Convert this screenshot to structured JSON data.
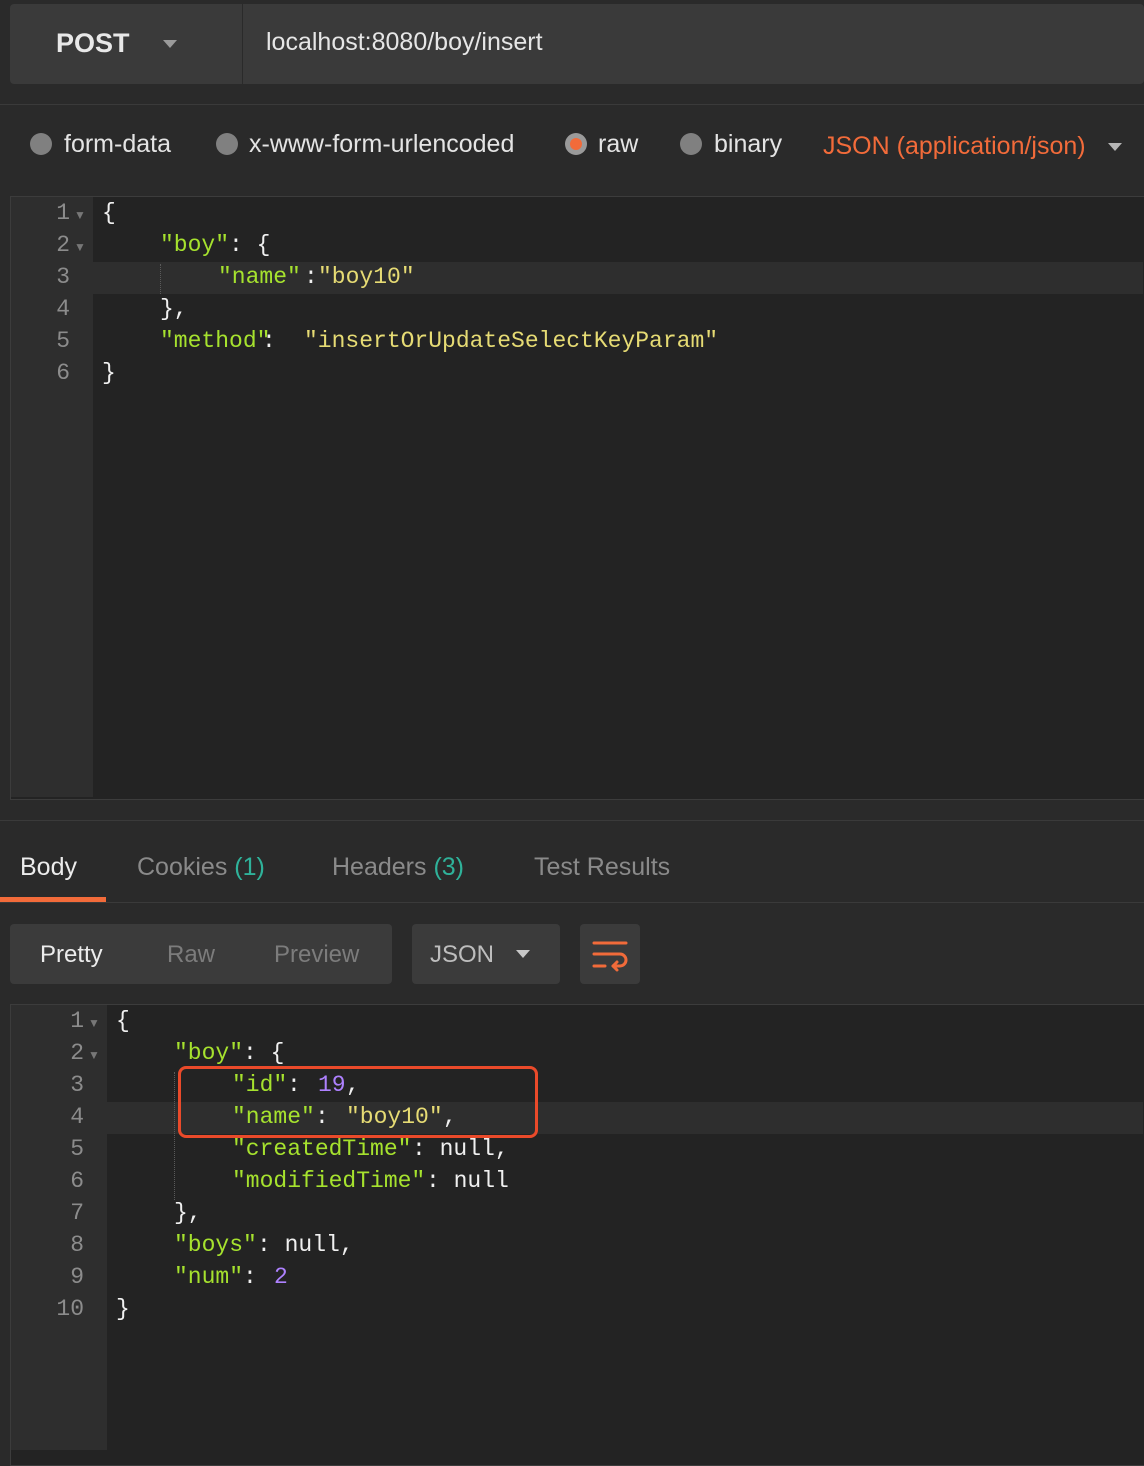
{
  "request": {
    "method": "POST",
    "url": "localhost:8080/boy/insert"
  },
  "body_types": {
    "options": [
      "form-data",
      "x-www-form-urlencoded",
      "raw",
      "binary"
    ],
    "selected": "raw",
    "content_type": "JSON (application/json)"
  },
  "request_body": {
    "line_numbers": [
      "1",
      "2",
      "3",
      "4",
      "5",
      "6"
    ],
    "tokens": {
      "open_brace": "{",
      "boy_key": "\"boy\"",
      "boy_colon": ": {",
      "name_key": "\"name\"",
      "name_colon": ":",
      "name_value": "\"boy10\"",
      "boy_close": "},",
      "method_key": "\"method\"",
      "method_colon": ": ",
      "method_value": "\"insertOrUpdateSelectKeyParam\"",
      "close_brace": "}"
    }
  },
  "response": {
    "tabs": [
      {
        "label": "Body",
        "count": ""
      },
      {
        "label": "Cookies",
        "count": "(1)"
      },
      {
        "label": "Headers",
        "count": "(3)"
      },
      {
        "label": "Test Results",
        "count": ""
      }
    ],
    "active_tab": "Body",
    "view_modes": [
      "Pretty",
      "Raw",
      "Preview"
    ],
    "active_view": "Pretty",
    "format": "JSON",
    "icons": {
      "wrap": "wrap-lines-icon"
    },
    "accent_color": "#f26b3a",
    "highlight_color": "#ea4a2a"
  },
  "response_body": {
    "line_numbers": [
      "1",
      "2",
      "3",
      "4",
      "5",
      "6",
      "7",
      "8",
      "9",
      "10"
    ],
    "tokens": {
      "open_brace": "{",
      "boy_key": "\"boy\"",
      "boy_colon": ": {",
      "id_key": "\"id\"",
      "id_colon": ": ",
      "id_value": "19",
      "id_comma": ",",
      "name_key": "\"name\"",
      "name_colon": ": ",
      "name_value": "\"boy10\"",
      "name_comma": ",",
      "created_key": "\"createdTime\"",
      "created_rest": ": null,",
      "modified_key": "\"modifiedTime\"",
      "modified_rest": ": null",
      "boy_close": "},",
      "boys_key": "\"boys\"",
      "boys_rest": ": null,",
      "num_key": "\"num\"",
      "num_colon": ": ",
      "num_value": "2",
      "close_brace": "}"
    }
  }
}
